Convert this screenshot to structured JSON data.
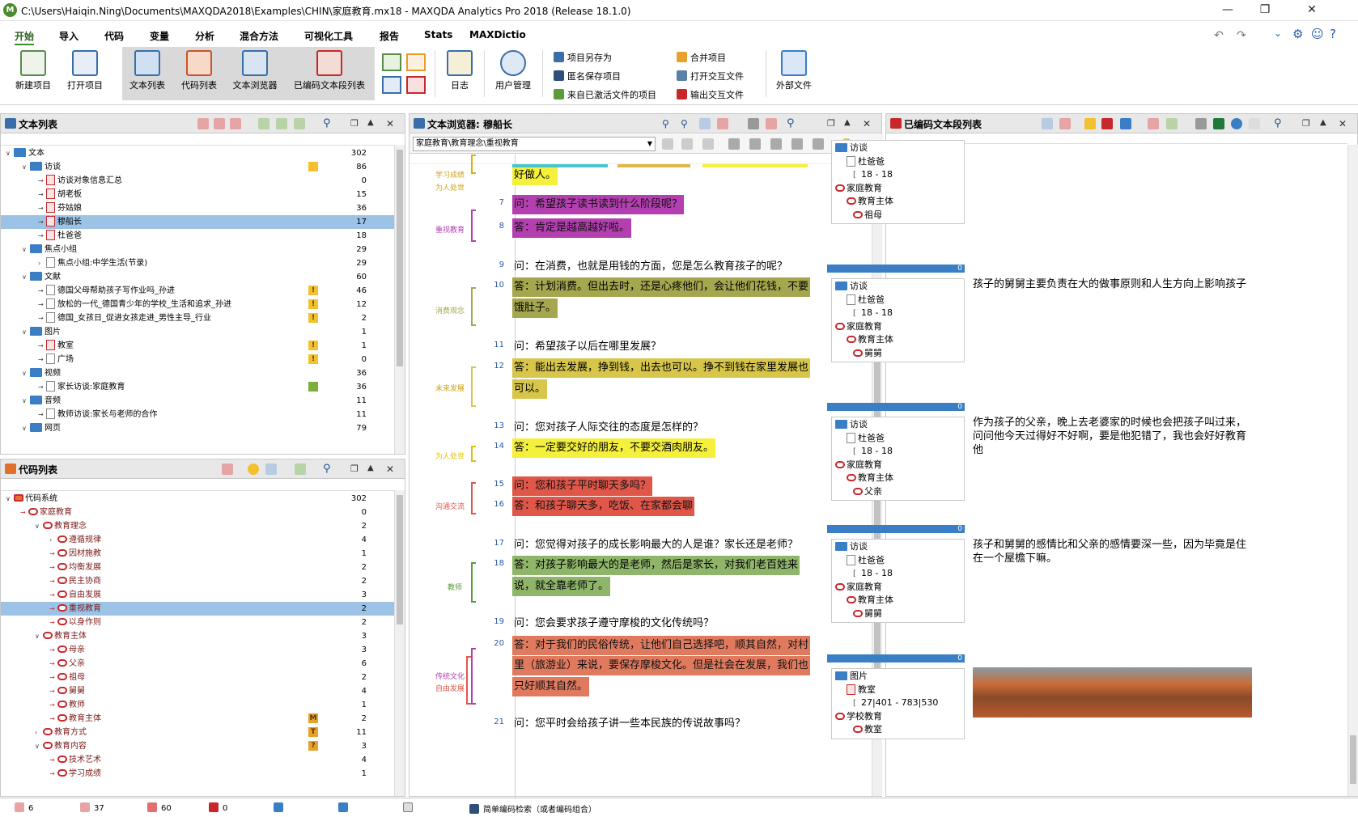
{
  "window": {
    "title": "C:\\Users\\Haiqin.Ning\\Documents\\MAXQDA2018\\Examples\\CHIN\\家庭教育.mx18 - MAXQDA Analytics Pro 2018 (Release 18.1.0)",
    "app_icon": "M"
  },
  "menu": [
    "开始",
    "导入",
    "代码",
    "变量",
    "分析",
    "混合方法",
    "可视化工具",
    "报告",
    "Stats",
    "MAXDictio"
  ],
  "ribbon": {
    "big": [
      "新建项目",
      "打开项目",
      "文本列表",
      "代码列表",
      "文本浏览器",
      "已编码文本段列表",
      "日志",
      "用户管理",
      "外部文件"
    ],
    "small": [
      "项目另存为",
      "匿名保存项目",
      "来自已激活文件的项目",
      "合并项目",
      "打开交互文件",
      "输出交互文件"
    ]
  },
  "doclist": {
    "title": "文本列表",
    "rows": [
      {
        "label": "文本",
        "count": "302"
      },
      {
        "label": "访谈",
        "count": "86"
      },
      {
        "label": "访谈对象信息汇总",
        "count": "0"
      },
      {
        "label": "胡老板",
        "count": "15"
      },
      {
        "label": "芬姑娘",
        "count": "36"
      },
      {
        "label": "穆船长",
        "count": "17"
      },
      {
        "label": "杜爸爸",
        "count": "18"
      },
      {
        "label": "焦点小组",
        "count": "29"
      },
      {
        "label": "焦点小组:中学生活(节录)",
        "count": "29"
      },
      {
        "label": "文献",
        "count": "60"
      },
      {
        "label": "德国父母帮助孩子写作业吗_孙进",
        "count": "46"
      },
      {
        "label": "放松的一代_德国青少年的学校_生活和追求_孙进",
        "count": "12"
      },
      {
        "label": "德国_女孩日_促进女孩走进_男性主导_行业",
        "count": "2"
      },
      {
        "label": "图片",
        "count": "1"
      },
      {
        "label": "教室",
        "count": "1"
      },
      {
        "label": "广场",
        "count": "0"
      },
      {
        "label": "视频",
        "count": "36"
      },
      {
        "label": "家长访谈:家庭教育",
        "count": "36"
      },
      {
        "label": "音频",
        "count": "11"
      },
      {
        "label": "教师访谈:家长与老师的合作",
        "count": "11"
      },
      {
        "label": "网页",
        "count": "79"
      }
    ]
  },
  "codelist": {
    "title": "代码列表",
    "rows": [
      {
        "label": "代码系统",
        "count": "302"
      },
      {
        "label": "家庭教育",
        "count": "0"
      },
      {
        "label": "教育理念",
        "count": "2"
      },
      {
        "label": "遵循规律",
        "count": "4"
      },
      {
        "label": "因材施教",
        "count": "1"
      },
      {
        "label": "均衡发展",
        "count": "2"
      },
      {
        "label": "民主协商",
        "count": "2"
      },
      {
        "label": "自由发展",
        "count": "3"
      },
      {
        "label": "重视教育",
        "count": "2"
      },
      {
        "label": "以身作则",
        "count": "2"
      },
      {
        "label": "教育主体",
        "count": "3"
      },
      {
        "label": "母亲",
        "count": "3"
      },
      {
        "label": "父亲",
        "count": "6"
      },
      {
        "label": "祖母",
        "count": "2"
      },
      {
        "label": "舅舅",
        "count": "4"
      },
      {
        "label": "教师",
        "count": "1"
      },
      {
        "label": "教育主体",
        "count": "2"
      },
      {
        "label": "教育方式",
        "count": "11"
      },
      {
        "label": "教育内容",
        "count": "3"
      },
      {
        "label": "技术艺术",
        "count": "4"
      },
      {
        "label": "学习成绩",
        "count": "1"
      }
    ]
  },
  "browser": {
    "title": "文本浏览器: 穆船长",
    "path": "家庭教育\\教育理念\\重视教育",
    "lines": [
      {
        "n": "",
        "t": "好做人。"
      },
      {
        "n": "7",
        "t": "问：希望孩子读书读到什么阶段呢？"
      },
      {
        "n": "8",
        "t": "答：肯定是越高越好啦。"
      },
      {
        "n": "9",
        "t": "问：在消费，也就是用钱的方面，您是怎么教育孩子的呢？"
      },
      {
        "n": "10",
        "t": "答：计划消费。但出去时，还是心疼他们，会让他们花钱，不要"
      },
      {
        "n": "",
        "t": "饿肚子。"
      },
      {
        "n": "11",
        "t": "问：希望孩子以后在哪里发展？"
      },
      {
        "n": "12",
        "t": "答：能出去发展，挣到钱，出去也可以。挣不到钱在家里发展也"
      },
      {
        "n": "",
        "t": "可以。"
      },
      {
        "n": "13",
        "t": "问：您对孩子人际交往的态度是怎样的？"
      },
      {
        "n": "14",
        "t": "答：一定要交好的朋友，不要交酒肉朋友。"
      },
      {
        "n": "15",
        "t": "问：您和孩子平时聊天多吗？"
      },
      {
        "n": "16",
        "t": "答：和孩子聊天多，吃饭、在家都会聊"
      },
      {
        "n": "17",
        "t": "问：您觉得对孩子的成长影响最大的人是谁？家长还是老师？"
      },
      {
        "n": "18",
        "t": "答：对孩子影响最大的是老师，然后是家长，对我们老百姓来"
      },
      {
        "n": "",
        "t": "说，就全靠老师了。"
      },
      {
        "n": "19",
        "t": "问：您会要求孩子遵守摩梭的文化传统吗？"
      },
      {
        "n": "20",
        "t": "答：对于我们的民俗传统，让他们自己选择吧，顺其自然，对村"
      },
      {
        "n": "",
        "t": "里（旅游业）来说，要保存摩梭文化。但是社会在发展，我们也"
      },
      {
        "n": "",
        "t": "只好顺其自然。"
      },
      {
        "n": "21",
        "t": "问：您平时会给孩子讲一些本民族的传说故事吗？"
      }
    ],
    "codes": [
      "学习成绩",
      "为人处世",
      "重视教育",
      "消费观念",
      "未来发展",
      "为人处世",
      "沟通交流",
      "教师",
      "传统文化",
      "自由发展"
    ]
  },
  "retrieved": {
    "title": "已编码文本段列表",
    "segments": [
      {
        "c": "",
        "doc": "访谈",
        "name": "杜爸爸",
        "range": "18 - 18",
        "root": "家庭教育",
        "parent": "教育主体",
        "code": "祖母",
        "text": ""
      },
      {
        "c": "0",
        "doc": "访谈",
        "name": "杜爸爸",
        "range": "18 - 18",
        "root": "家庭教育",
        "parent": "教育主体",
        "code": "舅舅",
        "text": "孩子的舅舅主要负责在大的做事原则和人生方向上影响孩子"
      },
      {
        "c": "0",
        "doc": "访谈",
        "name": "杜爸爸",
        "range": "18 - 18",
        "root": "家庭教育",
        "parent": "教育主体",
        "code": "父亲",
        "text": "作为孩子的父亲，晚上去老婆家的时候也会把孩子叫过来，问问他今天过得好不好啊，要是他犯错了，我也会好好教育他"
      },
      {
        "c": "0",
        "doc": "访谈",
        "name": "杜爸爸",
        "range": "18 - 18",
        "root": "家庭教育",
        "parent": "教育主体",
        "code": "舅舅",
        "text": "孩子和舅舅的感情比和父亲的感情要深一些，因为毕竟是住在一个屋檐下嘛。"
      },
      {
        "c": "0",
        "doc": "图片",
        "name": "教室",
        "range": "27|401 - 783|530",
        "root": "学校教育",
        "parent": "",
        "code": "教室",
        "text": ""
      }
    ]
  },
  "status": [
    "6",
    "37",
    "60",
    "0",
    "",
    "",
    "",
    "简单编码检索（或者编码组合）"
  ],
  "colors": {
    "accent": "#3e8a2e",
    "blue": "#3a7fc6",
    "red": "#c8282c"
  }
}
